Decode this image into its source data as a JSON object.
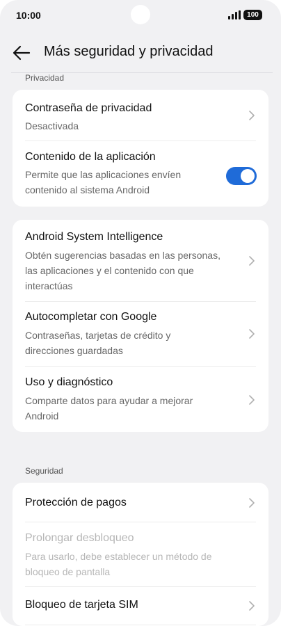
{
  "status_bar": {
    "time": "10:00",
    "battery": "100"
  },
  "header": {
    "title": "Más seguridad y privacidad"
  },
  "sections": {
    "privacy_label": "Privacidad",
    "security_label": "Seguridad"
  },
  "privacy_card": {
    "password": {
      "title": "Contraseña de privacidad",
      "subtitle": "Desactivada"
    },
    "app_content": {
      "title": "Contenido de la aplicación",
      "subtitle": "Permite que las aplicaciones envíen contenido al sistema Android",
      "enabled": true
    }
  },
  "intelligence_card": {
    "asi": {
      "title": "Android System Intelligence",
      "subtitle": "Obtén sugerencias basadas en las personas, las aplicaciones y el contenido con que interactúas"
    },
    "autofill": {
      "title": "Autocompletar con Google",
      "subtitle": "Contraseñas, tarjetas de crédito y direcciones guardadas"
    },
    "usage": {
      "title": "Uso y diagnóstico",
      "subtitle": "Comparte datos para ayudar a mejorar Android"
    }
  },
  "security_card": {
    "payment": {
      "title": "Protección de pagos"
    },
    "extend_unlock": {
      "title": "Prolongar desbloqueo",
      "subtitle": "Para usarlo, debe establecer un método de bloqueo de pantalla"
    },
    "sim_lock": {
      "title": "Bloqueo de tarjeta SIM"
    }
  },
  "colors": {
    "accent": "#1f6bd8",
    "background": "#f1f1f3",
    "card": "#ffffff"
  }
}
